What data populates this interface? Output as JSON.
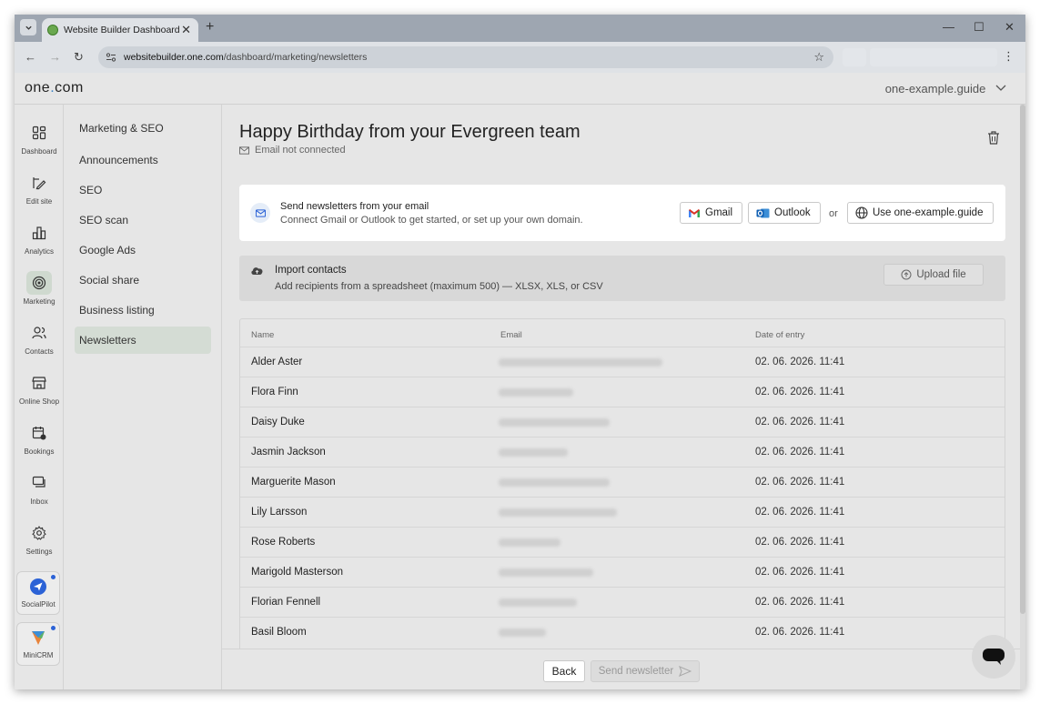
{
  "browser": {
    "tab_title": "Website Builder Dashboard",
    "url_host": "websitebuilder.one.com",
    "url_path": "/dashboard/marketing/newsletters"
  },
  "app": {
    "logo_text": "one",
    "logo_dot": ".",
    "logo_suffix": "com",
    "site_name": "one-example.guide"
  },
  "rail": {
    "items": [
      {
        "label": "Dashboard",
        "icon": "dashboard-icon"
      },
      {
        "label": "Edit site",
        "icon": "edit-site-icon"
      },
      {
        "label": "Analytics",
        "icon": "analytics-icon"
      },
      {
        "label": "Marketing",
        "icon": "target-icon"
      },
      {
        "label": "Contacts",
        "icon": "contacts-icon"
      },
      {
        "label": "Online Shop",
        "icon": "shop-icon"
      },
      {
        "label": "Bookings",
        "icon": "calendar-icon"
      },
      {
        "label": "Inbox",
        "icon": "chat-icon"
      },
      {
        "label": "Settings",
        "icon": "gear-icon"
      }
    ],
    "apps": [
      {
        "label": "SocialPilot",
        "icon": "socialpilot-icon"
      },
      {
        "label": "MiniCRM",
        "icon": "minicrm-icon"
      }
    ]
  },
  "submenu": {
    "heading": "Marketing & SEO",
    "items": [
      "Announcements",
      "SEO",
      "SEO scan",
      "Google Ads",
      "Social share",
      "Business listing",
      "Newsletters"
    ]
  },
  "main": {
    "title": "Happy Birthday from your Evergreen team",
    "email_status": "Email not connected",
    "connect": {
      "title": "Send newsletters from your email",
      "subtitle": "Connect Gmail or Outlook to get started, or set up your own domain.",
      "gmail_label": "Gmail",
      "outlook_label": "Outlook",
      "or_label": "or",
      "domain_label": "Use one-example.guide"
    },
    "import": {
      "title": "Import contacts",
      "subtitle": "Add recipients from a spreadsheet (maximum 500) — XLSX, XLS, or CSV",
      "upload_label": "Upload file"
    },
    "table": {
      "headers": [
        "Name",
        "Email",
        "Date of entry"
      ],
      "rows": [
        {
          "name": "Alder Aster",
          "date": "02. 06. 2026. 11:41"
        },
        {
          "name": "Flora Finn",
          "date": "02. 06. 2026. 11:41"
        },
        {
          "name": "Daisy Duke",
          "date": "02. 06. 2026. 11:41"
        },
        {
          "name": "Jasmin Jackson",
          "date": "02. 06. 2026. 11:41"
        },
        {
          "name": "Marguerite Mason",
          "date": "02. 06. 2026. 11:41"
        },
        {
          "name": "Lily Larsson",
          "date": "02. 06. 2026. 11:41"
        },
        {
          "name": "Rose Roberts",
          "date": "02. 06. 2026. 11:41"
        },
        {
          "name": "Marigold Masterson",
          "date": "02. 06. 2026. 11:41"
        },
        {
          "name": "Florian Fennell",
          "date": "02. 06. 2026. 11:41"
        },
        {
          "name": "Basil Bloom",
          "date": "02. 06. 2026. 11:41"
        }
      ]
    },
    "footer": {
      "back_label": "Back",
      "send_label": "Send newsletter"
    }
  },
  "colors": {
    "accent_blue": "#2b62d6",
    "active_nav": "#d4dcd4"
  }
}
